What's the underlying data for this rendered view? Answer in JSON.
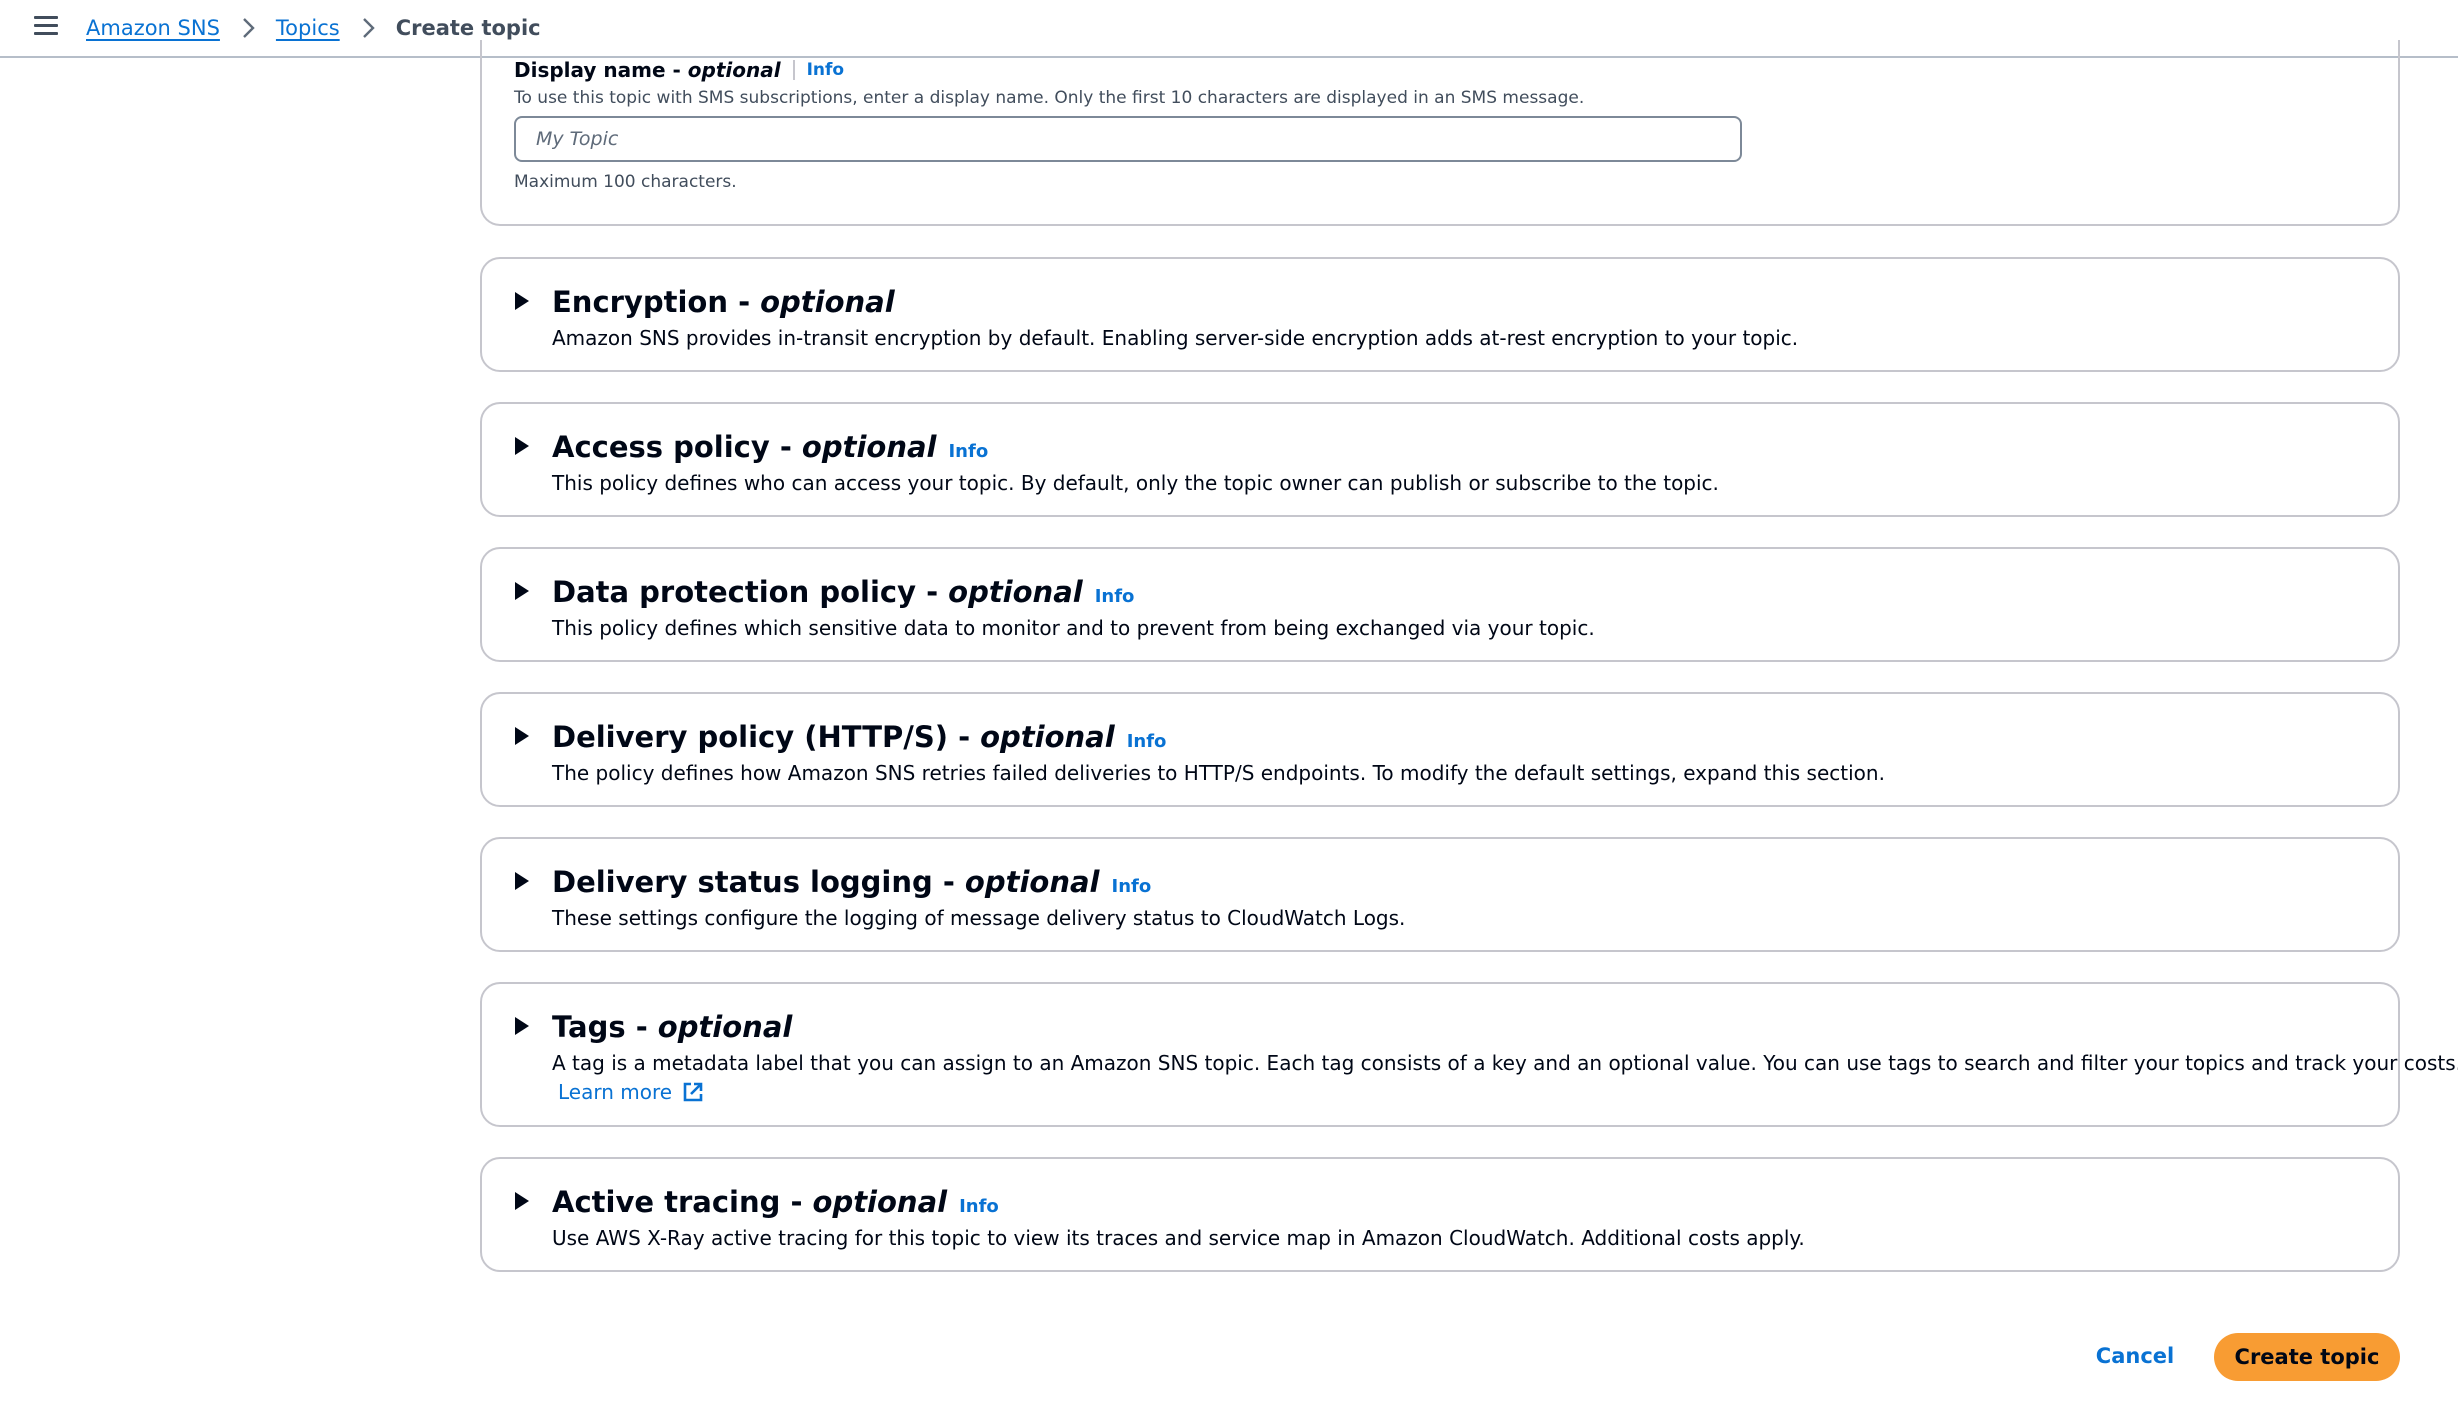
{
  "breadcrumb": {
    "items": [
      "Amazon SNS",
      "Topics"
    ],
    "current": "Create topic"
  },
  "display_name": {
    "label": "Display name -",
    "optional": "optional",
    "info": "Info",
    "description": "To use this topic with SMS subscriptions, enter a display name. Only the first 10 characters are displayed in an SMS message.",
    "placeholder": "My Topic",
    "value": "",
    "constraint": "Maximum 100 characters."
  },
  "sections": [
    {
      "title": "Encryption -",
      "optional": "optional",
      "info": "",
      "description": "Amazon SNS provides in-transit encryption by default. Enabling server-side encryption adds at-rest encryption to your topic."
    },
    {
      "title": "Access policy -",
      "optional": "optional",
      "info": "Info",
      "description": "This policy defines who can access your topic. By default, only the topic owner can publish or subscribe to the topic."
    },
    {
      "title": "Data protection policy -",
      "optional": "optional",
      "info": "Info",
      "description": "This policy defines which sensitive data to monitor and to prevent from being exchanged via your topic."
    },
    {
      "title": "Delivery policy (HTTP/S) -",
      "optional": "optional",
      "info": "Info",
      "description": "The policy defines how Amazon SNS retries failed deliveries to HTTP/S endpoints. To modify the default settings, expand this section."
    },
    {
      "title": "Delivery status logging -",
      "optional": "optional",
      "info": "Info",
      "description": "These settings configure the logging of message delivery status to CloudWatch Logs."
    },
    {
      "title": "Tags -",
      "optional": "optional",
      "info": "",
      "description": "A tag is a metadata label that you can assign to an Amazon SNS topic. Each tag consists of a key and an optional value. You can use tags to search and filter your topics and track your costs.",
      "link": "Learn more"
    },
    {
      "title": "Active tracing -",
      "optional": "optional",
      "info": "Info",
      "description": "Use AWS X-Ray active tracing for this topic to view its traces and service map in Amazon CloudWatch. Additional costs apply."
    }
  ],
  "actions": {
    "cancel": "Cancel",
    "create": "Create topic"
  },
  "colors": {
    "link": "#0972d3",
    "primary_button": "#f89c33",
    "border": "#c6c6cd"
  }
}
